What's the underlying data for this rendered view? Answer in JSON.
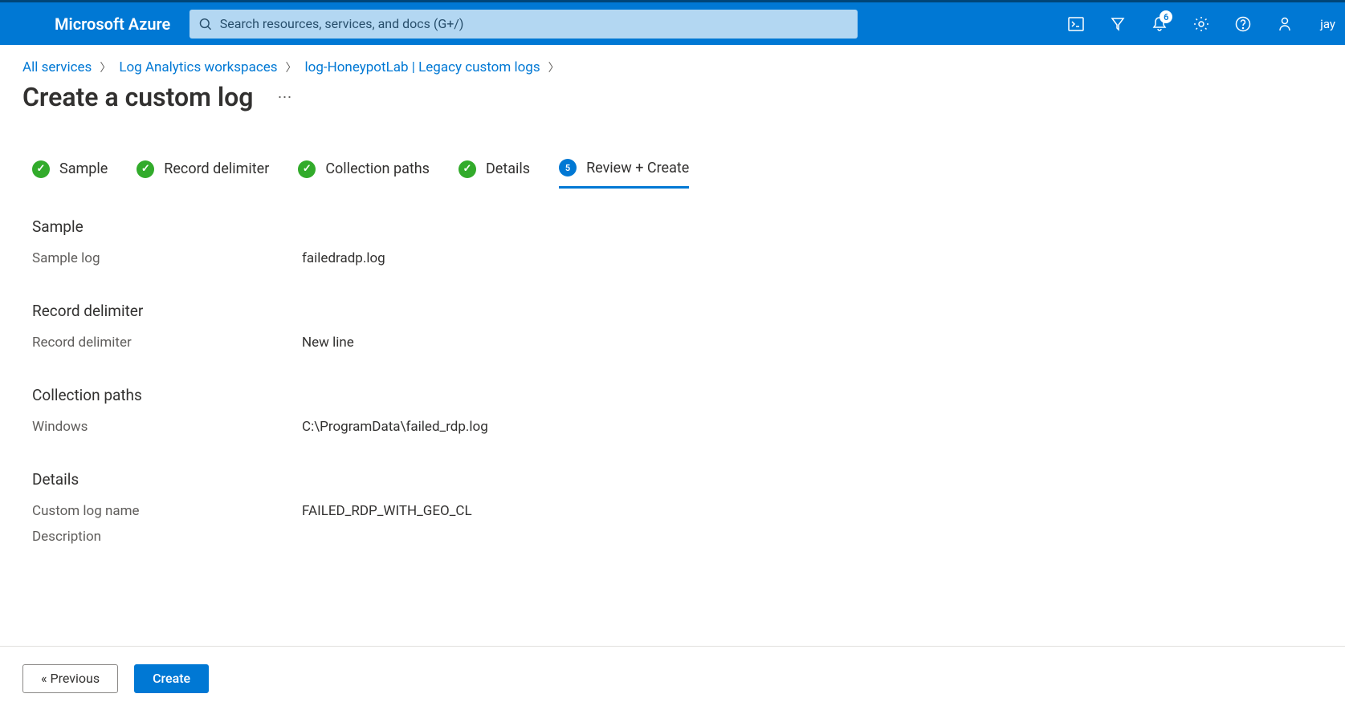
{
  "header": {
    "brand": "Microsoft Azure",
    "search_placeholder": "Search resources, services, and docs (G+/)",
    "notification_count": "6",
    "user_label": "jay"
  },
  "breadcrumb": {
    "items": [
      "All services",
      "Log Analytics workspaces",
      "log-HoneypotLab | Legacy custom logs"
    ]
  },
  "page": {
    "title": "Create a custom log"
  },
  "wizard": {
    "steps": [
      {
        "label": "Sample",
        "state": "done"
      },
      {
        "label": "Record delimiter",
        "state": "done"
      },
      {
        "label": "Collection paths",
        "state": "done"
      },
      {
        "label": "Details",
        "state": "done"
      },
      {
        "label": "Review + Create",
        "state": "active",
        "num": "5"
      }
    ]
  },
  "sections": {
    "sample": {
      "title": "Sample",
      "rows": [
        {
          "label": "Sample log",
          "value": "failedradp.log"
        }
      ]
    },
    "record_delimiter": {
      "title": "Record delimiter",
      "rows": [
        {
          "label": "Record delimiter",
          "value": "New line"
        }
      ]
    },
    "collection_paths": {
      "title": "Collection paths",
      "rows": [
        {
          "label": "Windows",
          "value": "C:\\ProgramData\\failed_rdp.log"
        }
      ]
    },
    "details": {
      "title": "Details",
      "rows": [
        {
          "label": "Custom log name",
          "value": "FAILED_RDP_WITH_GEO_CL"
        },
        {
          "label": "Description",
          "value": ""
        }
      ]
    }
  },
  "footer": {
    "previous_label": "« Previous",
    "create_label": "Create"
  }
}
